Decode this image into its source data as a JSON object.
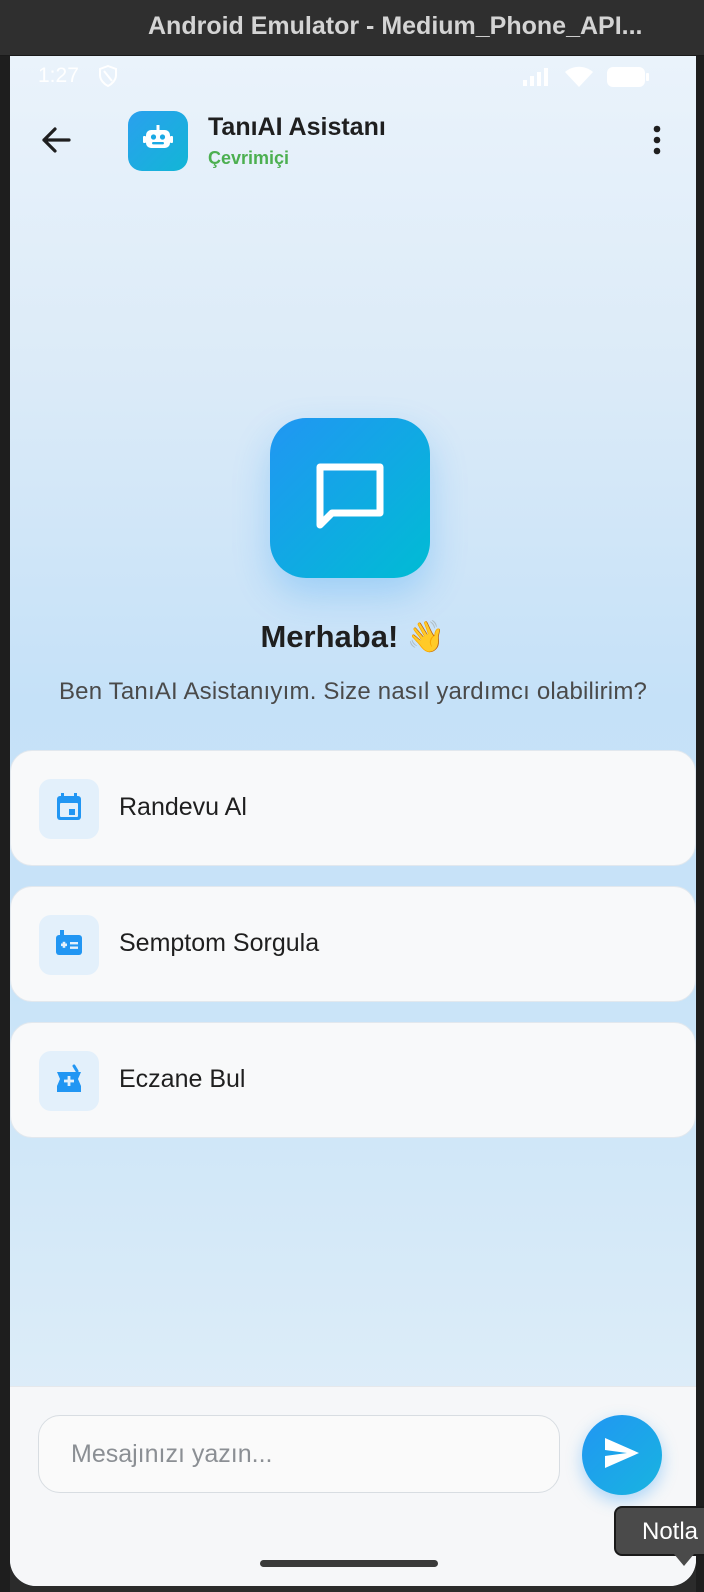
{
  "window": {
    "title": "Android Emulator - Medium_Phone_API..."
  },
  "status_bar": {
    "time": "1:27",
    "icons": [
      "shield-icon",
      "signal-icon",
      "wifi-icon",
      "battery-icon"
    ]
  },
  "header": {
    "title": "TanıAI Asistanı",
    "status": "Çevrimiçi",
    "back_icon": "arrow-left-icon",
    "avatar_icon": "robot-icon",
    "menu_icon": "more-vertical-icon"
  },
  "hero": {
    "icon": "chat-bubble-icon",
    "title": "Merhaba! 👋",
    "subtitle": "Ben TanıAI Asistanıyım. Size nasıl yardımcı olabilirim?"
  },
  "actions": [
    {
      "label": "Randevu Al",
      "icon": "calendar-icon"
    },
    {
      "label": "Semptom Sorgula",
      "icon": "medical-kit-icon"
    },
    {
      "label": "Eczane Bul",
      "icon": "pharmacy-icon"
    }
  ],
  "composer": {
    "placeholder": "Mesajınızı yazın...",
    "value": "",
    "send_icon": "send-icon"
  },
  "tooltip": {
    "text": "Notla"
  },
  "colors": {
    "accent": "#2196F3",
    "accent_secondary": "#00BCD4",
    "online": "#4CAF50",
    "card_bg": "#F8F9FA",
    "icon_bg": "#E3F0FB"
  }
}
